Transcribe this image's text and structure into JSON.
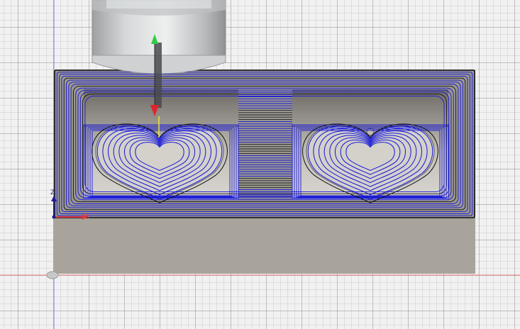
{
  "viewport": {
    "title": "",
    "axes": {
      "z_label": "Z",
      "x_label": "X"
    }
  },
  "colors": {
    "toolpath": "#1414d8",
    "stock_top": "#9a9790",
    "stock_side": "#a8a49c",
    "pocket_floor": "#77746e",
    "tool_body": "#c9cbcc",
    "origin_x_axis": "#e23a3a",
    "origin_y_axis": "#3b5bd9",
    "origin_z_axis": "#1d1d8a",
    "tool_marker_start": "#2ecc40",
    "tool_marker_end": "#e0242b"
  },
  "icons": {
    "tool": "end-mill-icon",
    "origin": "origin-icon"
  }
}
